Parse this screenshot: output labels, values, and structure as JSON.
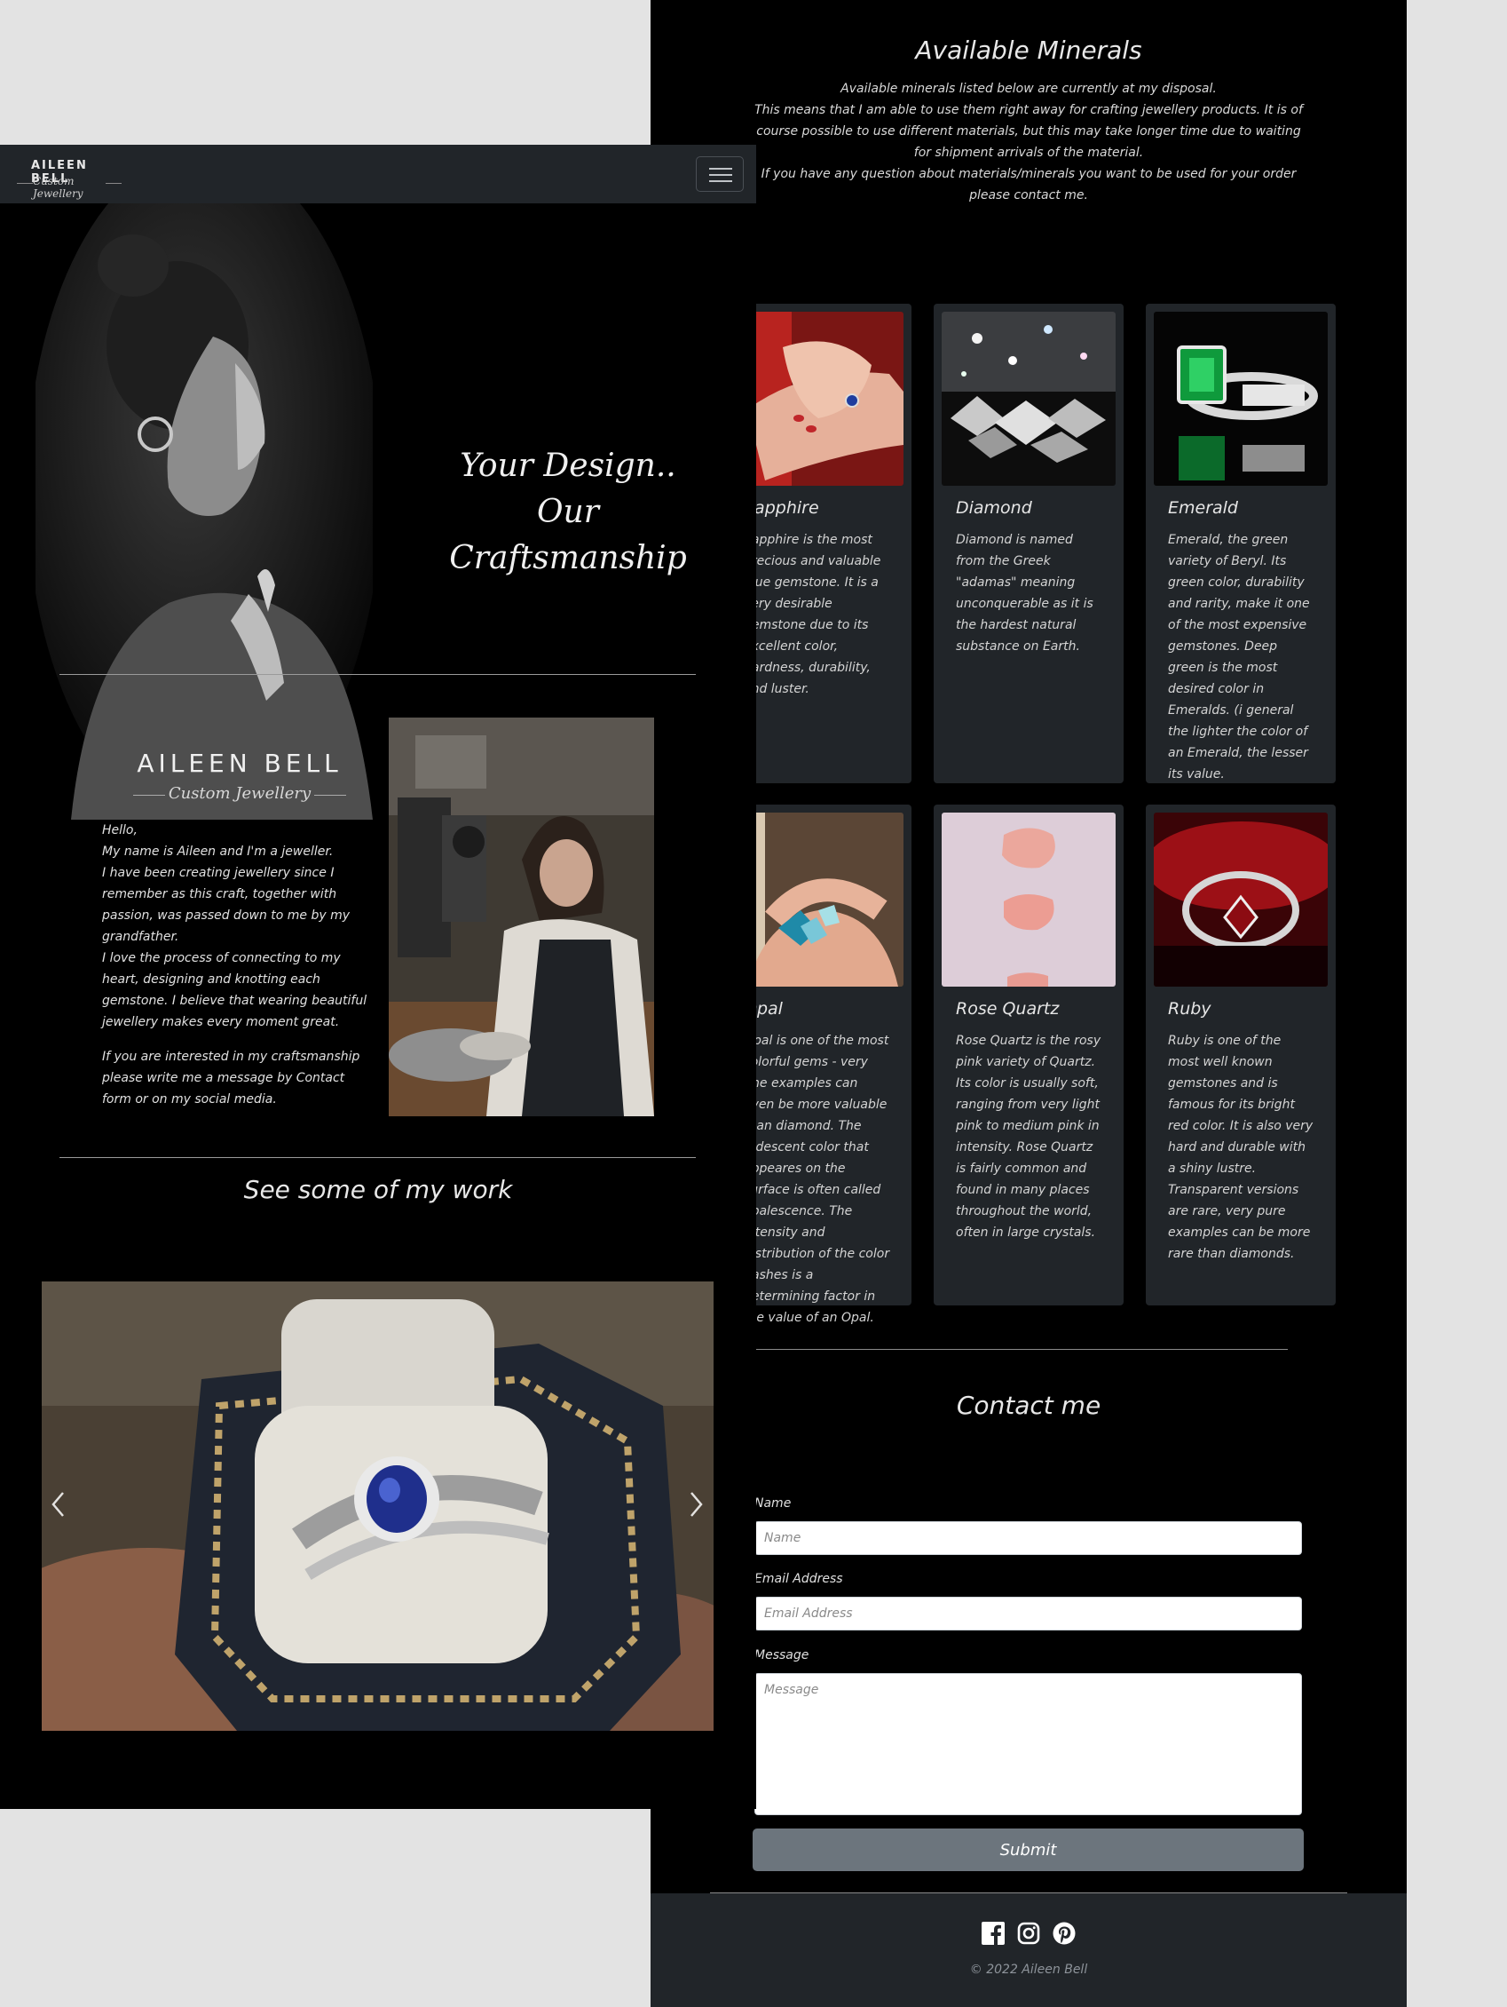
{
  "navbar": {
    "brand_name": "AILEEN BELL",
    "brand_tagline": "Custom Jewellery"
  },
  "hero": {
    "tagline_line1": "Your Design.. Our",
    "tagline_line2": "Craftsmanship"
  },
  "about": {
    "logo_name": "AILEEN BELL",
    "logo_tagline": "Custom Jewellery",
    "paragraph1": "Hello,\nMy name is Aileen and I'm a jeweller.\nI have been creating jewellery since I remember as this craft, together with passion, was passed down to me by my grandfather.\nI love the process of connecting to my heart, designing and knotting each gemstone. I believe that wearing beautiful jewellery makes every moment great.",
    "paragraph2": "If you are interested in my craftsmanship please write me a message by Contact form or on my social media."
  },
  "work": {
    "title": "See some of my work"
  },
  "minerals": {
    "title": "Available Minerals",
    "intro": [
      "Available minerals listed below are currently at my disposal.",
      "This means that I am able to use them right away for crafting jewellery products. It is of course possible to use different materials, but this may take longer time due to waiting for shipment arrivals of the material.",
      "If you have any question about materials/minerals you want to be used for your order please contact me."
    ],
    "cards": [
      {
        "title": "Sapphire",
        "text": "Sapphire is the most precious and valuable blue gemstone. It is a very desirable gemstone due to its excellent color, hardness, durability, and luster."
      },
      {
        "title": "Diamond",
        "text": "Diamond is named from the Greek \"adamas\" meaning unconquerable as it is the hardest natural substance on Earth."
      },
      {
        "title": "Emerald",
        "text": "Emerald, the green variety of Beryl. Its green color, durability and rarity, make it one of the most expensive gemstones. Deep green is the most desired color in Emeralds. (i general the lighter the color of an Emerald, the lesser its value."
      },
      {
        "title": "Opal",
        "text": "Opal is one of the most colorful gems - very fine examples can even be more valuable than diamond. The iridescent color that appeares on the surface is often called opalescence. The intensity and distribution of the color flashes is a determining factor in the value of an Opal."
      },
      {
        "title": "Rose Quartz",
        "text": "Rose Quartz is the rosy pink variety of Quartz. Its color is usually soft, ranging from very light pink to medium pink in intensity. Rose Quartz is fairly common and found in many places throughout the world, often in large crystals."
      },
      {
        "title": "Ruby",
        "text": "Ruby is one of the most well known gemstones and is famous for its bright red color. It is also very hard and durable with a shiny lustre. Transparent versions are rare, very pure examples can be more rare than diamonds."
      }
    ]
  },
  "contact": {
    "title": "Contact me",
    "name_label": "Name",
    "name_placeholder": "Name",
    "email_label": "Email Address",
    "email_placeholder": "Email Address",
    "message_label": "Message",
    "message_placeholder": "Message",
    "submit_label": "Submit"
  },
  "footer": {
    "icons": [
      "facebook-icon",
      "instagram-icon",
      "pinterest-icon"
    ],
    "copyright": "© 2022 Aileen Bell"
  },
  "colors": {
    "page_bg": "#000000",
    "nav_bg": "#212529",
    "card_bg": "#212529",
    "button_bg": "#6c757d",
    "outer_bg": "#e3e3e3"
  }
}
